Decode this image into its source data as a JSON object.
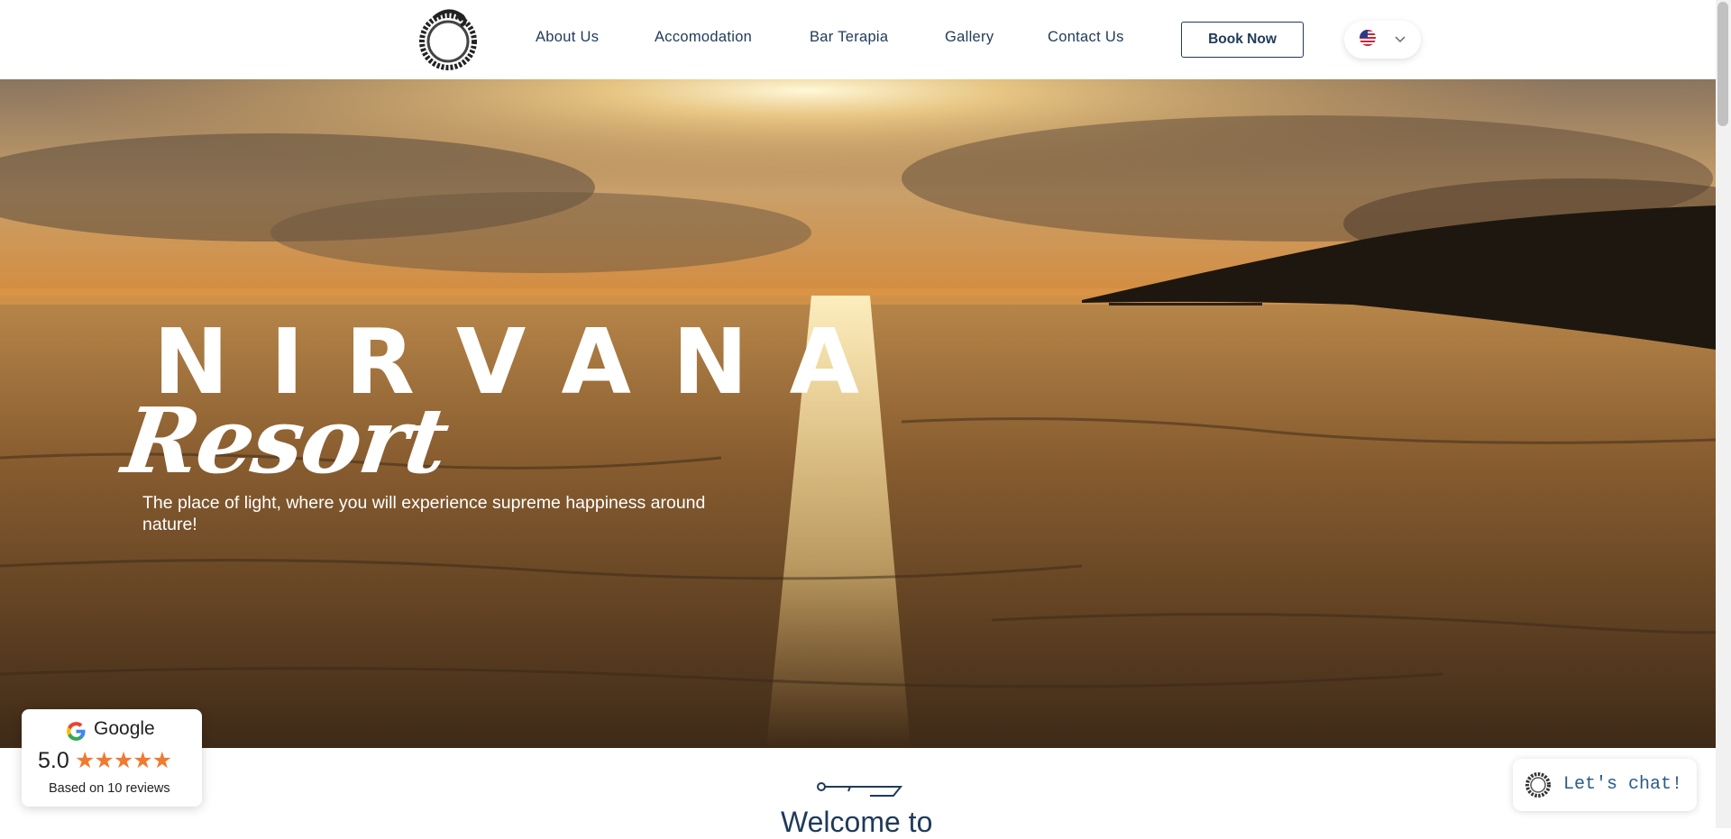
{
  "nav": {
    "links": [
      "About Us",
      "Accomodation",
      "Bar Terapia",
      "Gallery",
      "Contact Us"
    ],
    "book_label": "Book Now",
    "language_flag": "us-flag-icon"
  },
  "hero": {
    "brand": "NIRVANA",
    "script": "Resort",
    "tagline": "The place of light, where you will experience supreme happiness around nature!"
  },
  "welcome": {
    "heading": "Welcome to"
  },
  "google_widget": {
    "label": "Google",
    "score": "5.0",
    "stars": "★★★★★",
    "reviews": "Based on 10 reviews",
    "rating": 5,
    "max_rating": 5
  },
  "chat": {
    "label": "Let's chat!"
  },
  "colors": {
    "navy": "#1f3a5a",
    "star_orange": "#f07a2f",
    "sunset": "#c98a3a"
  }
}
